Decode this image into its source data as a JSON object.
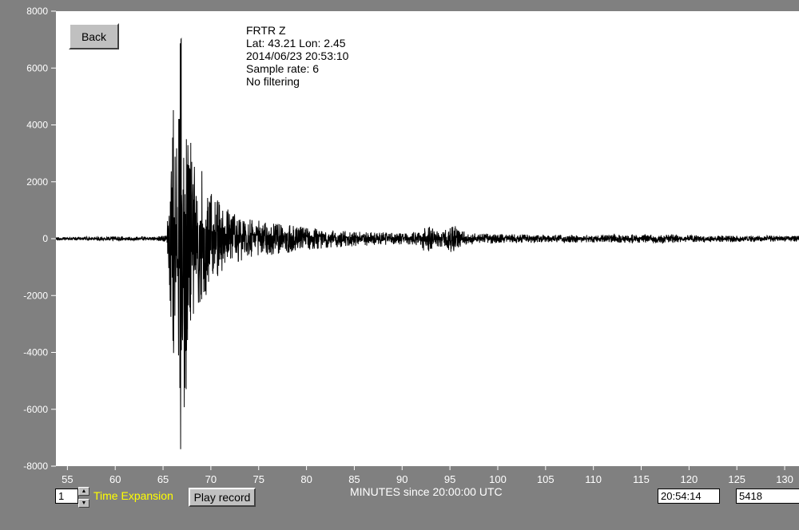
{
  "header": {
    "station": "FRTR  Z",
    "location": "Lat: 43.21 Lon: 2.45",
    "datetime": "2014/06/23 20:53:10",
    "sample_rate": "Sample rate: 6",
    "filter": "No filtering"
  },
  "buttons": {
    "back_label": "Back",
    "play_label": "Play record"
  },
  "controls": {
    "expansion_value": "1",
    "expansion_label": "Time Expansion",
    "cursor_time": "20:54:14",
    "cursor_count": "5418",
    "spin_up": "▲",
    "spin_down": "▼"
  },
  "colors": {
    "background": "#808080",
    "plot_background": "#ffffff",
    "trace": "#000000",
    "axis_text": "#ffffff",
    "expansion_label": "#ffff00"
  },
  "chart_data": {
    "type": "line",
    "title": "",
    "xlabel": "MINUTES since 20:00:00 UTC",
    "ylabel": "",
    "xlim": [
      53.8,
      131.5
    ],
    "ylim": [
      -8000,
      8000
    ],
    "grid": false,
    "x_ticks": [
      55,
      60,
      65,
      70,
      75,
      80,
      85,
      90,
      95,
      100,
      105,
      110,
      115,
      120,
      125,
      130
    ],
    "x_tick_labels": [
      "55",
      "60",
      "65",
      "70",
      "75",
      "80",
      "85",
      "90",
      "95",
      "100",
      "105",
      "110",
      "115",
      "120",
      "125",
      "130"
    ],
    "y_ticks": [
      8000,
      6000,
      4000,
      2000,
      0,
      -2000,
      -4000,
      -6000,
      -8000
    ],
    "y_tick_labels": [
      "8000",
      "6000",
      "4000",
      "2000",
      "0",
      "-2000",
      "-4000",
      "-6000",
      "-8000"
    ],
    "series": [
      {
        "envelope": [
          [
            53.8,
            60
          ],
          [
            58,
            70
          ],
          [
            60,
            80
          ],
          [
            62,
            70
          ],
          [
            64,
            70
          ],
          [
            65.4,
            120
          ],
          [
            65.6,
            2000
          ],
          [
            65.9,
            3600
          ],
          [
            66.1,
            5600
          ],
          [
            66.3,
            3000
          ],
          [
            66.5,
            4000
          ],
          [
            66.8,
            7800
          ],
          [
            67.1,
            6500
          ],
          [
            67.5,
            5000
          ],
          [
            68.0,
            3000
          ],
          [
            68.5,
            2200
          ],
          [
            69.0,
            2500
          ],
          [
            69.5,
            2200
          ],
          [
            70.0,
            1700
          ],
          [
            71.0,
            1300
          ],
          [
            72.0,
            1000
          ],
          [
            73.0,
            800
          ],
          [
            74.0,
            700
          ],
          [
            75.0,
            650
          ],
          [
            76.0,
            600
          ],
          [
            78.0,
            500
          ],
          [
            80.0,
            400
          ],
          [
            82.0,
            330
          ],
          [
            84.0,
            300
          ],
          [
            86.0,
            250
          ],
          [
            88.0,
            220
          ],
          [
            90.0,
            200
          ],
          [
            91.5,
            250
          ],
          [
            92.5,
            500
          ],
          [
            93.5,
            300
          ],
          [
            94.5,
            300
          ],
          [
            95.2,
            550
          ],
          [
            96.0,
            300
          ],
          [
            97.0,
            200
          ],
          [
            100.0,
            170
          ],
          [
            105.0,
            140
          ],
          [
            110.0,
            130
          ],
          [
            114.0,
            150
          ],
          [
            117.0,
            170
          ],
          [
            120.0,
            130
          ],
          [
            125.0,
            110
          ],
          [
            131.5,
            100
          ]
        ]
      }
    ]
  }
}
